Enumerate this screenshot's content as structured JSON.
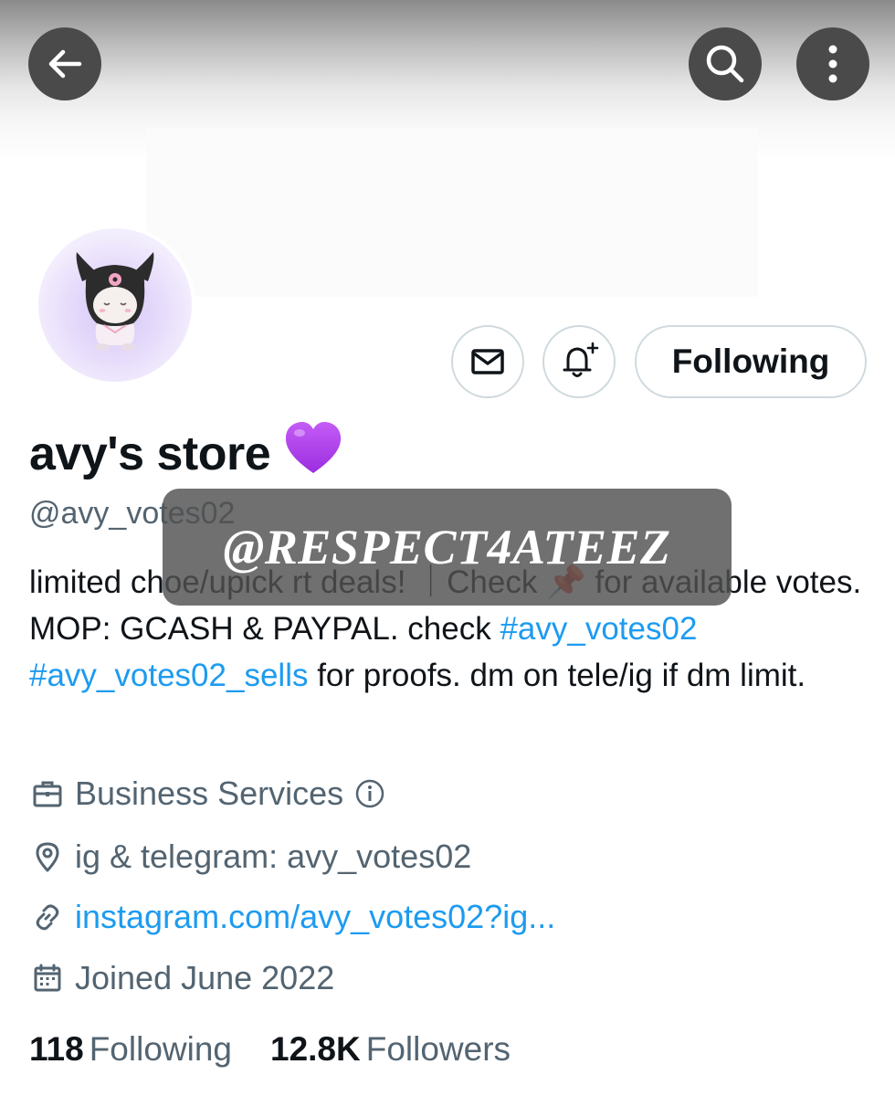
{
  "profile": {
    "display_name": "avy's store",
    "name_emoji": "purple-heart-icon",
    "handle": "@avy_votes02",
    "bio": {
      "line1_part1": "limited choe/upick rt deals! ｜Check ",
      "pin_emoji": "📌",
      "line1_part2": " for available votes. MOP: GCASH & PAYPAL. check ",
      "tag1": "#avy_votes02",
      "space": " ",
      "tag2": "#avy_votes02_sells",
      "line_end": " for proofs. dm on tele/ig if dm limit."
    },
    "category": "Business Services",
    "location": "ig & telegram: avy_votes02",
    "website": "instagram.com/avy_votes02?ig...",
    "joined": "Joined June 2022"
  },
  "stats": {
    "following_count": "118",
    "following_label": "Following",
    "followers_count": "12.8K",
    "followers_label": "Followers"
  },
  "actions": {
    "following_button": "Following"
  },
  "watermark": {
    "text": "@RESPECT4ATEEZ"
  },
  "colors": {
    "link": "#1d9bf0",
    "secondary_text": "#536471",
    "primary_text": "#0f1419",
    "nav_button_bg": "#4a4a4a"
  }
}
